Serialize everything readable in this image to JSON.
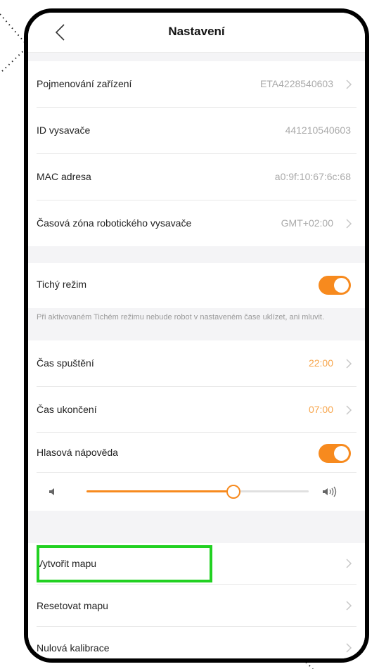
{
  "nav": {
    "title": "Nastavení"
  },
  "device": {
    "naming_label": "Pojmenování zařízení",
    "naming_value": "ETA4228540603",
    "id_label": "ID vysavače",
    "id_value": "441210540603",
    "mac_label": "MAC adresa",
    "mac_value": "a0:9f:10:67:6c:68",
    "timezone_label": "Časová zóna robotického vysavače",
    "timezone_value": "GMT+02:00"
  },
  "quiet": {
    "label": "Tichý režim",
    "enabled": true,
    "note": "Při aktivovaném Tichém režimu nebude robot v nastaveném čase uklízet, ani mluvit.",
    "start_label": "Čas spuštění",
    "start_value": "22:00",
    "end_label": "Čas ukončení",
    "end_value": "07:00"
  },
  "voice": {
    "label": "Hlasová nápověda",
    "enabled": true,
    "volume_fraction": 0.66
  },
  "map": {
    "create_label": "Vytvořit mapu",
    "reset_label": "Resetovat mapu",
    "calibration_label": "Nulová kalibrace"
  },
  "colors": {
    "accent": "#f78a1e",
    "accent_text": "#f7a54b",
    "highlight": "#22d122",
    "band": "#f4f4f6"
  },
  "icons": {
    "back": "chevron-left-icon",
    "row_arrow": "chevron-right-icon",
    "volume_low": "speaker-low-icon",
    "volume_high": "speaker-high-icon"
  }
}
